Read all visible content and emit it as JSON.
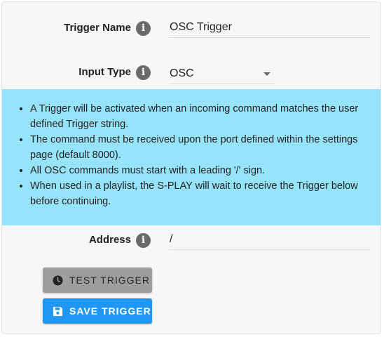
{
  "form": {
    "trigger_name": {
      "label": "Trigger Name",
      "value": "OSC Trigger"
    },
    "input_type": {
      "label": "Input Type",
      "selected": "OSC"
    },
    "address": {
      "label": "Address",
      "value": "/"
    }
  },
  "info": {
    "items": [
      "A Trigger will be activated when an incoming command matches the user defined Trigger string.",
      "The command must be received upon the port defined within the settings page (default 8000).",
      "All OSC commands must start with a leading '/' sign.",
      "When used in a playlist, the S-PLAY will wait to receive the Trigger below before continuing."
    ]
  },
  "buttons": {
    "test_label": "TEST TRIGGER",
    "save_label": "SAVE TRIGGER"
  },
  "icons": {
    "info": "info-icon",
    "test": "clock-icon",
    "save": "floppy-disk-icon"
  },
  "colors": {
    "info_box": "#96e4fc",
    "save_button": "#2196f3",
    "test_button": "#9e9e9e"
  }
}
